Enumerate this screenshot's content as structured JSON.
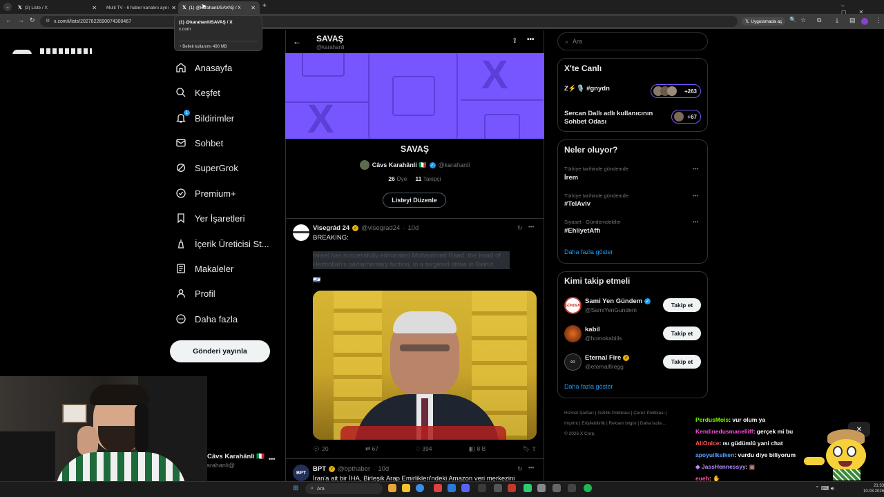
{
  "browser": {
    "tabs": [
      {
        "title": "(3) Liste / X"
      },
      {
        "title": "Multi TV - 6 haber kanalını aynı"
      },
      {
        "title": "(1) @karahanli/SAVAŞ / X"
      }
    ],
    "url": "x.com/i/lists/2027822690074300467",
    "popup_title": "(1) @karahanli/SAVAŞ / X",
    "popup_domain": "x.com",
    "popup_memory": "Bellek kullanımı 490 MB",
    "open_in_app": "Uygulamada aç"
  },
  "nav": {
    "items": [
      {
        "label": "Anasayfa",
        "icon": "home-icon"
      },
      {
        "label": "Keşfet",
        "icon": "search-icon"
      },
      {
        "label": "Bildirimler",
        "icon": "bell-icon",
        "badge": "1"
      },
      {
        "label": "Sohbet",
        "icon": "mail-icon"
      },
      {
        "label": "SuperGrok",
        "icon": "grok-icon"
      },
      {
        "label": "Premium+",
        "icon": "premium-icon"
      },
      {
        "label": "Yer İşaretleri",
        "icon": "bookmark-icon"
      },
      {
        "label": "İçerik Üreticisi St...",
        "icon": "creator-icon"
      },
      {
        "label": "Makaleler",
        "icon": "articles-icon"
      },
      {
        "label": "Profil",
        "icon": "profile-icon"
      },
      {
        "label": "Daha fazla",
        "icon": "more-icon"
      }
    ],
    "post_button": "Gönderi yayınla",
    "account_name": "Câvs Karahânli 🇮🇹",
    "account_handle": "@karahanli"
  },
  "list": {
    "header_title": "SAVAŞ",
    "header_handle": "@karahanli",
    "name": "SAVAŞ",
    "owner_name": "Câvs Karahânli 🇮🇹",
    "owner_handle": "@karahanli",
    "members_count": "26",
    "members_label": "Üye",
    "followers_count": "11",
    "followers_label": "Takipçi",
    "edit_button": "Listeyi Düzenle"
  },
  "posts": [
    {
      "author": "Visegrád 24",
      "handle": "@visegrad24",
      "time": "10d",
      "text_line1": "BREAKING:",
      "text_body": "Israel has successfully eliminated Mohammed Raad, the head of Hezbollah's parliamentary faction, in a targeted strike in Beirut.",
      "flag": "🇮🇱",
      "replies": "20",
      "reposts": "67",
      "likes": "394",
      "views": "8 B"
    },
    {
      "author": "BPT",
      "handle": "@bpthaber",
      "time": "10d",
      "text_line1": "İran'a ait bir İHA, Birleşik Arap Emirlikleri'ndeki Amazon veri merkezini"
    }
  ],
  "right": {
    "search_placeholder": "Ara",
    "live_title": "X'te Canlı",
    "live_items": [
      {
        "title": "Z⚡🎙️ #gnydn",
        "count": "+263"
      },
      {
        "title": "Sercan Dallı adlı kullanıcının Sohbet Odası",
        "count": "+67"
      }
    ],
    "trends_title": "Neler oluyor?",
    "trends": [
      {
        "context": "Türkiye tarihinde gündemde",
        "name": "İrem"
      },
      {
        "context": "Türkiye tarihinde gündemde",
        "name": "#TelAviv"
      },
      {
        "context": "Siyaset · Gündemdekiler",
        "name": "#EhliyetAffı"
      }
    ],
    "show_more": "Daha fazla göster",
    "follow_title": "Kimi takip etmeli",
    "follow_items": [
      {
        "name": "Sami Yen Gündem",
        "handle": "@SamiYenGundem",
        "button": "Takip et"
      },
      {
        "name": "kabil",
        "handle": "@homokabilis",
        "button": "Takip et"
      },
      {
        "name": "Eternal Fire",
        "handle": "@eternalfiregg",
        "button": "Takip et"
      }
    ],
    "footer_links": [
      "Hizmet Şartları",
      "Gizlilik Politikası",
      "Çerez Politikası",
      "Imprint",
      "Erişilebilirlik",
      "Reklam bilgisi",
      "Daha fazla ..."
    ],
    "copyright": "© 2026 X Corp."
  },
  "chat": [
    {
      "user": "PerdusMois",
      "color": "#7cfc00",
      "msg": ": vur olum ya"
    },
    {
      "user": "Kendinedusmanelliff",
      "color": "#ff4fd8",
      "msg": ": gerçek mi bu"
    },
    {
      "user": "AliOnlce",
      "color": "#ff5a5a",
      "msg": ": ısı güdümlü yani chat"
    },
    {
      "user": "apoyuilksiken",
      "color": "#5aa0ff",
      "msg": ": vurdu diye biliyorum"
    },
    {
      "user": "JassHennessyy",
      "color": "#b58cff",
      "msg": ":"
    },
    {
      "user": "eueh",
      "color": "#ff5aa0",
      "msg": ":"
    }
  ],
  "taskbar": {
    "search": "Ara",
    "time": "21:33",
    "date": "10.03.2026"
  }
}
